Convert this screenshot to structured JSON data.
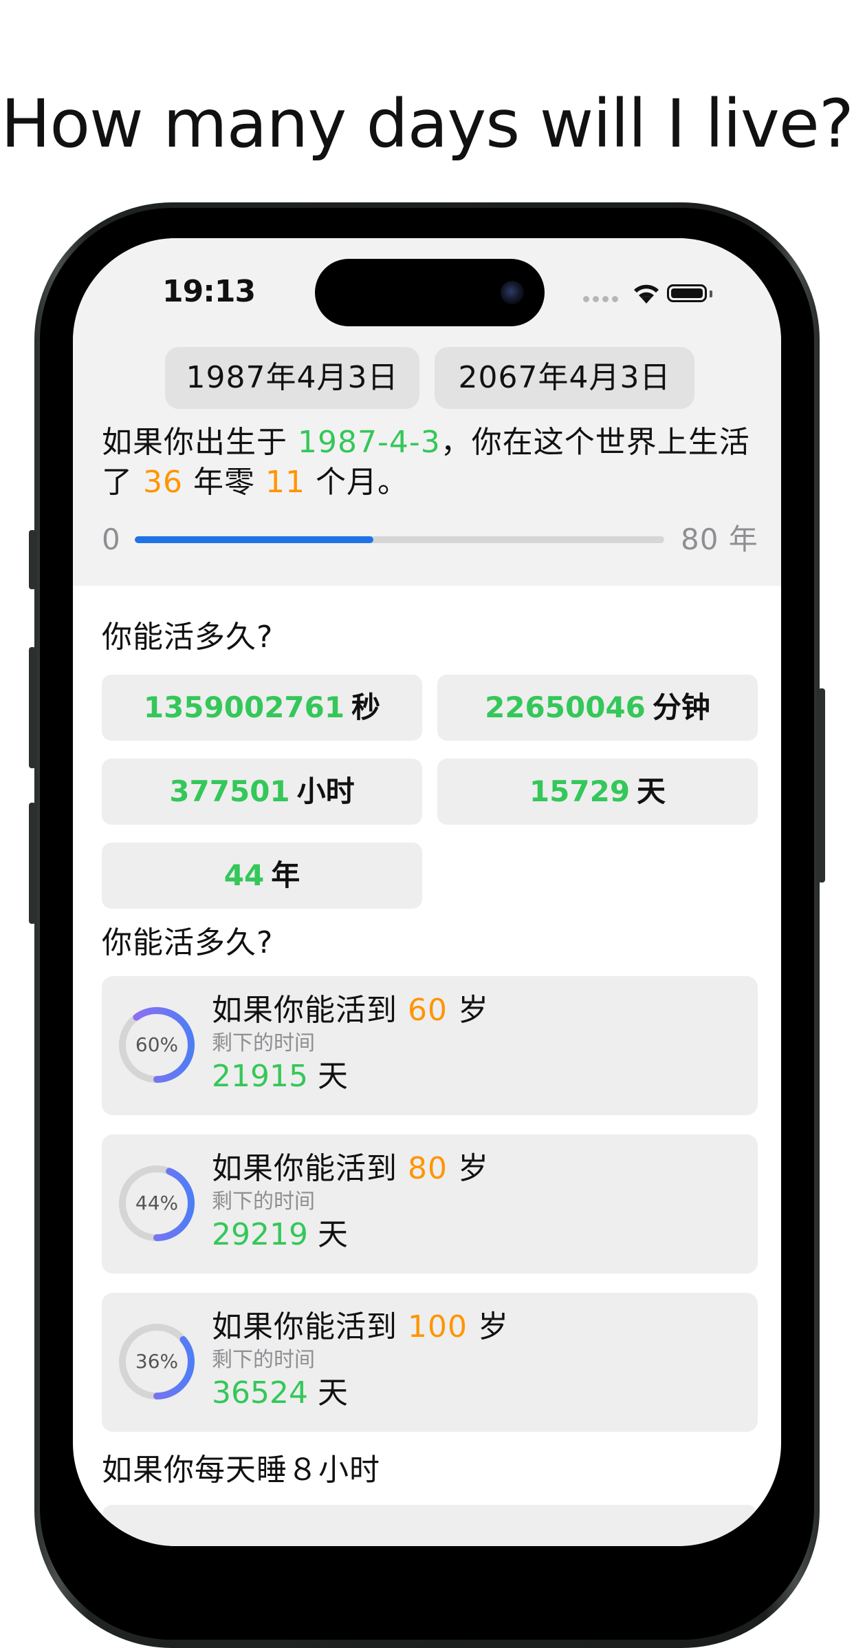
{
  "headline": "How many days will I live?",
  "status_bar": {
    "time": "19:13"
  },
  "dates": {
    "birth": "1987年4月3日",
    "end": "2067年4月3日"
  },
  "summary": {
    "prefix": "如果你出生于 ",
    "birth_date": "1987-4-3",
    "middle": "，你在这个世界上生活了 ",
    "years": "36",
    "years_suffix": " 年零 ",
    "months": "11",
    "months_suffix": " 个月。"
  },
  "progress": {
    "start_label": "0",
    "end_label": "80 年",
    "fraction": 0.45,
    "color": "#1f73e6"
  },
  "section1": {
    "title": "你能活多久?",
    "stats": [
      {
        "value": "1359002761",
        "unit": "秒"
      },
      {
        "value": "22650046",
        "unit": "分钟"
      },
      {
        "value": "377501",
        "unit": "小时"
      },
      {
        "value": "15729",
        "unit": "天"
      },
      {
        "value": "44",
        "unit": "年"
      }
    ]
  },
  "section2": {
    "title": "你能活多久?",
    "cards": [
      {
        "prefix": "如果你能活到 ",
        "age": "60",
        "suffix": " 岁",
        "subtitle": "剩下的时间",
        "days": "21915",
        "unit": " 天",
        "percent_label": "60%",
        "percent": 0.6
      },
      {
        "prefix": "如果你能活到 ",
        "age": "80",
        "suffix": " 岁",
        "subtitle": "剩下的时间",
        "days": "29219",
        "unit": " 天",
        "percent_label": "44%",
        "percent": 0.44
      },
      {
        "prefix": "如果你能活到 ",
        "age": "100",
        "suffix": " 岁",
        "subtitle": "剩下的时间",
        "days": "36524",
        "unit": " 天",
        "percent_label": "36%",
        "percent": 0.36
      }
    ]
  },
  "section3": {
    "title": "如果你每天睡８小时"
  },
  "colors": {
    "accent_green": "#34c759",
    "accent_orange": "#ff9500",
    "ring_start": "#9b6cf0",
    "ring_end": "#4f7df5",
    "ring_track": "#d5d5d5"
  },
  "icons": [
    "signal-dots-icon",
    "wifi-icon",
    "battery-icon",
    "camera-lens-icon"
  ]
}
